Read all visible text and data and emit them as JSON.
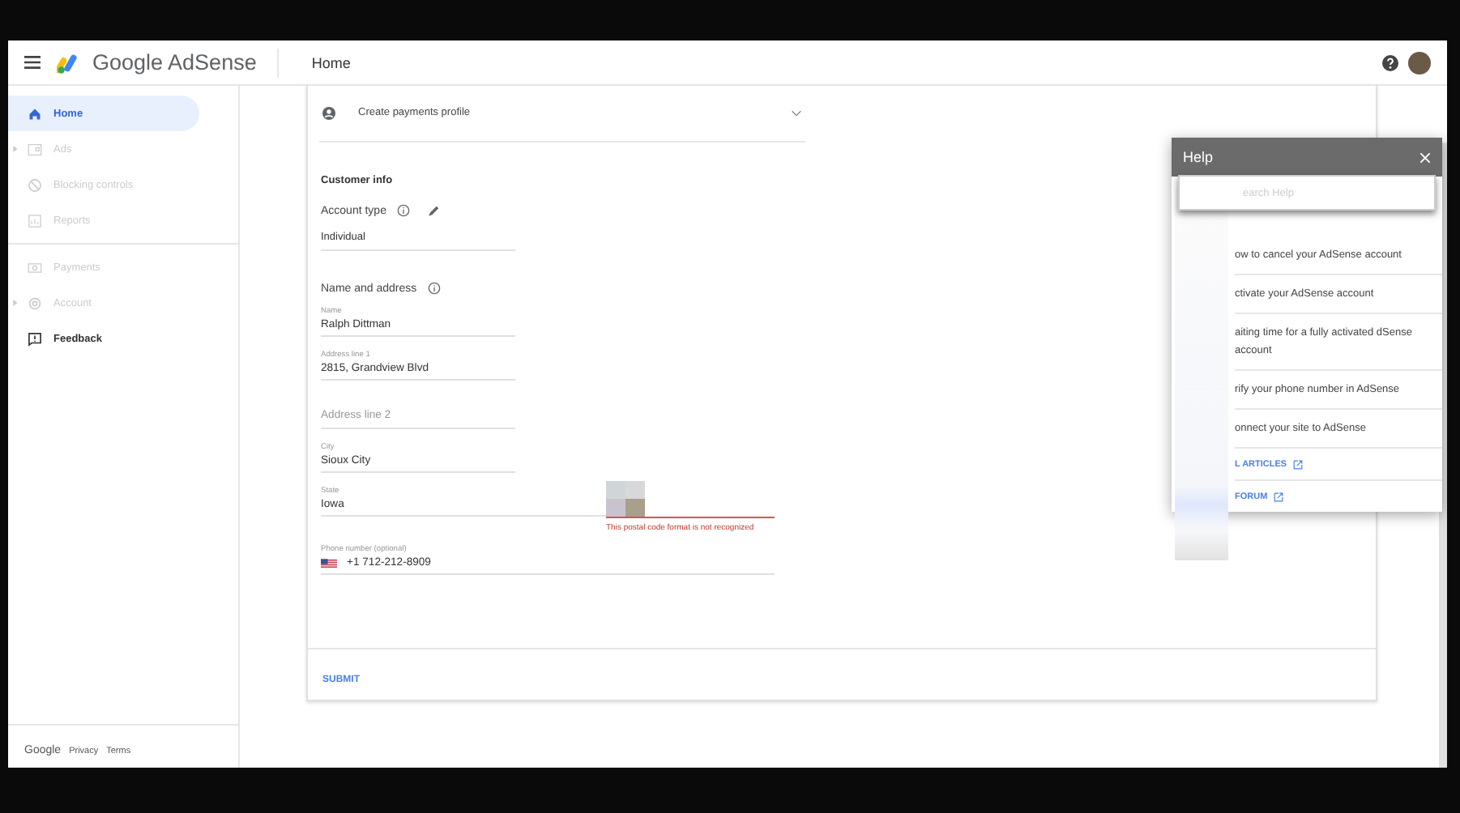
{
  "topbar": {
    "product": "Google AdSense",
    "page": "Home"
  },
  "sidebar": {
    "items": [
      {
        "label": "Home",
        "kind": "home",
        "selected": true,
        "disabled": false,
        "expandable": false
      },
      {
        "label": "Ads",
        "kind": "ads",
        "selected": false,
        "disabled": true,
        "expandable": true
      },
      {
        "label": "Blocking controls",
        "kind": "block",
        "selected": false,
        "disabled": true,
        "expandable": false
      },
      {
        "label": "Reports",
        "kind": "reports",
        "selected": false,
        "disabled": true,
        "expandable": false
      },
      {
        "label": "Payments",
        "kind": "payments",
        "selected": false,
        "disabled": true,
        "expandable": false
      },
      {
        "label": "Account",
        "kind": "account",
        "selected": false,
        "disabled": true,
        "expandable": true
      },
      {
        "label": "Feedback",
        "kind": "feedback",
        "selected": false,
        "disabled": false,
        "expandable": false
      }
    ],
    "footer": [
      "Google",
      "Privacy",
      "Terms"
    ]
  },
  "card": {
    "header": "Create payments profile",
    "section": "Customer info",
    "account_type": {
      "label": "Account type",
      "value": "Individual"
    },
    "name_address_label": "Name and address",
    "fields": [
      {
        "label": "Name",
        "value": "Ralph Dittman"
      },
      {
        "label": "Address line 1",
        "value": "2815, Grandview Blvd"
      },
      {
        "placeholder": "Address line 2"
      },
      {
        "label": "City",
        "value": "Sioux City"
      },
      {
        "label": "State",
        "value": "Iowa",
        "kind": "state"
      }
    ],
    "postal_error": "This postal code format is not recognized",
    "phone": {
      "label": "Phone number (optional)",
      "value": "+1 712-212-8909"
    },
    "submit": "SUBMIT"
  },
  "help": {
    "title": "Help",
    "search_placeholder": "earch Help",
    "articles": [
      "ow to cancel your AdSense account",
      "ctivate your AdSense account",
      "aiting time for a fully activated dSense account",
      "rify your phone number in AdSense",
      "onnect your site to AdSense"
    ],
    "links": [
      "L ARTICLES",
      "FORUM"
    ]
  }
}
